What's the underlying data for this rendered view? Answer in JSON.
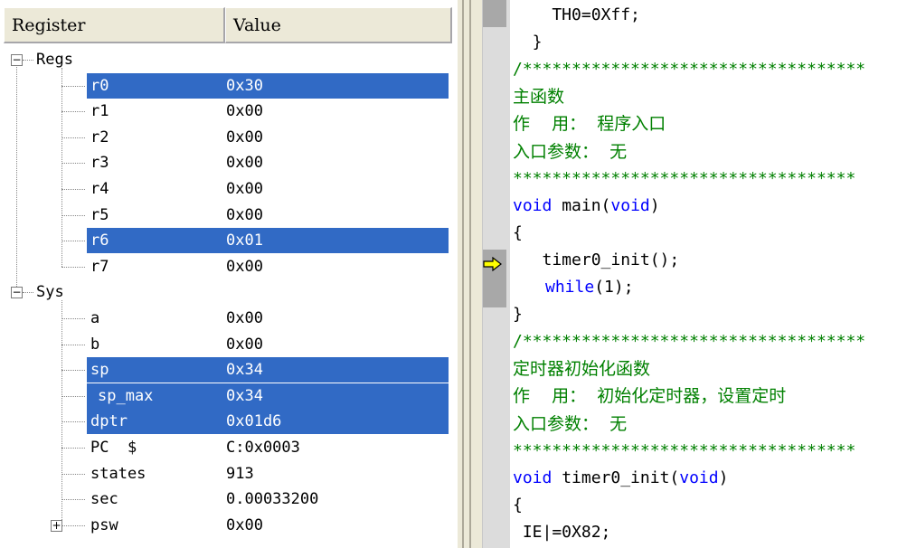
{
  "registers": {
    "header": {
      "col_register": "Register",
      "col_value": "Value"
    },
    "groups": [
      {
        "label": "Regs",
        "expanded": true,
        "items": [
          {
            "name": "r0",
            "value": "0x30",
            "selected": true
          },
          {
            "name": "r1",
            "value": "0x00",
            "selected": false
          },
          {
            "name": "r2",
            "value": "0x00",
            "selected": false
          },
          {
            "name": "r3",
            "value": "0x00",
            "selected": false
          },
          {
            "name": "r4",
            "value": "0x00",
            "selected": false
          },
          {
            "name": "r5",
            "value": "0x00",
            "selected": false
          },
          {
            "name": "r6",
            "value": "0x01",
            "selected": true
          },
          {
            "name": "r7",
            "value": "0x00",
            "selected": false
          }
        ]
      },
      {
        "label": "Sys",
        "expanded": true,
        "items": [
          {
            "name": "a",
            "value": "0x00",
            "selected": false
          },
          {
            "name": "b",
            "value": "0x00",
            "selected": false
          },
          {
            "name": "sp",
            "value": "0x34",
            "selected": true
          },
          {
            "name": "sp_max",
            "value": "0x34",
            "selected": true
          },
          {
            "name": "dptr",
            "value": "0x01d6",
            "selected": true
          },
          {
            "name": "PC  $",
            "value": "C:0x0003",
            "selected": false
          },
          {
            "name": "states",
            "value": "913",
            "selected": false
          },
          {
            "name": "sec",
            "value": "0.00033200",
            "selected": false
          },
          {
            "name": "psw",
            "value": "0x00",
            "selected": false,
            "collapsed": true
          }
        ]
      }
    ]
  },
  "code": {
    "lines": [
      {
        "text": "    TH0=0Xff;",
        "type": "code"
      },
      {
        "text": "  }",
        "type": "code"
      },
      {
        "text": "/***********************************",
        "type": "comment"
      },
      {
        "text": "主函数",
        "type": "comment-cn"
      },
      {
        "text": "作    用：  程序入口",
        "type": "comment-cn"
      },
      {
        "text": "入口参数：  无",
        "type": "comment-cn"
      },
      {
        "text": "***********************************",
        "type": "comment"
      },
      {
        "kw1": "void",
        "mid": " main(",
        "kw2": "void",
        "end": ")",
        "type": "decl"
      },
      {
        "text": "{",
        "type": "code"
      },
      {
        "text": "   timer0_init();",
        "type": "code"
      },
      {
        "kw1": "while",
        "mid": "(1);",
        "type": "while"
      },
      {
        "text": "}",
        "type": "code"
      },
      {
        "text": "/***********************************",
        "type": "comment"
      },
      {
        "text": "定时器初始化函数",
        "type": "comment-cn"
      },
      {
        "text": "作    用：  初始化定时器，设置定时",
        "type": "comment-cn"
      },
      {
        "text": "入口参数：  无",
        "type": "comment-cn"
      },
      {
        "text": "***********************************",
        "type": "comment"
      },
      {
        "kw1": "void",
        "mid": " timer0_init(",
        "kw2": "void",
        "end": ")",
        "type": "decl"
      },
      {
        "text": "{",
        "type": "code"
      },
      {
        "text": " IE|=0X82;",
        "type": "code"
      }
    ],
    "current_line_icon": "yellow-arrow-icon"
  },
  "colors": {
    "selection": "#316ac5",
    "comment": "#008000",
    "keyword": "#0000ff"
  }
}
